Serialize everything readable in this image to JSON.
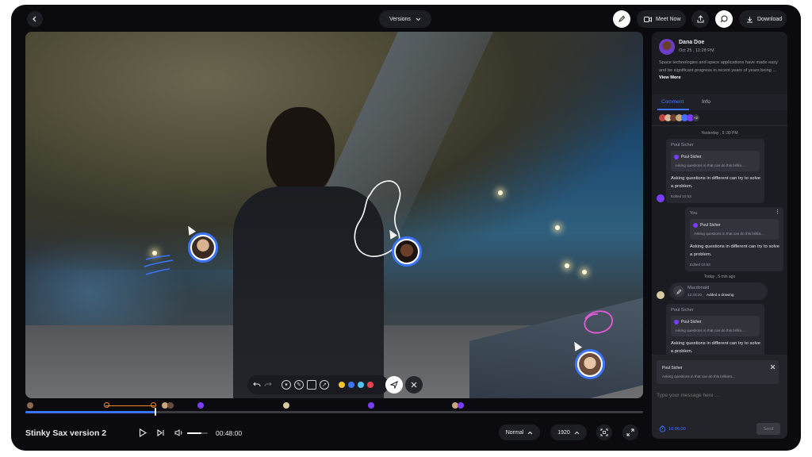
{
  "topbar": {
    "versions_label": "Versions",
    "meet_now_label": "Meet Now",
    "download_label": "Download"
  },
  "video": {
    "title": "Stinky Sax version 2",
    "time": "00:48:00",
    "playback_speed": "Normal",
    "resolution": "1920",
    "progress_fraction": 0.21,
    "volume_fraction": 0.7
  },
  "annotation_colors": [
    "#f2c230",
    "#3d74ff",
    "#4fc3f7",
    "#e84355"
  ],
  "panel": {
    "author": "Dana Doe",
    "date": "Oct 25 , 11:28 PM",
    "description": "Space technologies and space applications have made easy and be significant progress in recent years of years being ...",
    "view_more": "View More",
    "tabs": [
      "Comment",
      "Info"
    ],
    "participants_extra": "+2",
    "day_label_1": "Yesterday , 5 :30 PM",
    "messages": [
      {
        "sender": "Poul Sicher",
        "quote_name": "Poul Sicher",
        "quote_text": "Asking questions in that can do this brillia...",
        "text": "Asking questions in different can try to solve a problem.",
        "edited": "Edited   10:53"
      },
      {
        "sender": "You",
        "quote_name": "Poul Sicher",
        "quote_text": "Asking questions in that can do this brillia...",
        "text": "Asking questions in different can try to solve a problem.",
        "edited": "Edited   10:53"
      }
    ],
    "day_label_2": "Today , 5 min ago",
    "drawing_event": {
      "user": "Macdonald",
      "time": "12:43:20",
      "action": "Added a drawing"
    },
    "message_3": {
      "sender": "Poul Sicher",
      "quote_name": "Poul Sicher",
      "quote_text": "Asking questions in that can do this brillia...",
      "text": "Asking questions in different can try to solve a problem."
    },
    "reply_preview": {
      "name": "Poul Sicher",
      "text": "Asking questions in that can do this brilliant..."
    },
    "input_placeholder": "Type your message here ...",
    "timestamp": "10:06:00",
    "send_label": "Send"
  }
}
